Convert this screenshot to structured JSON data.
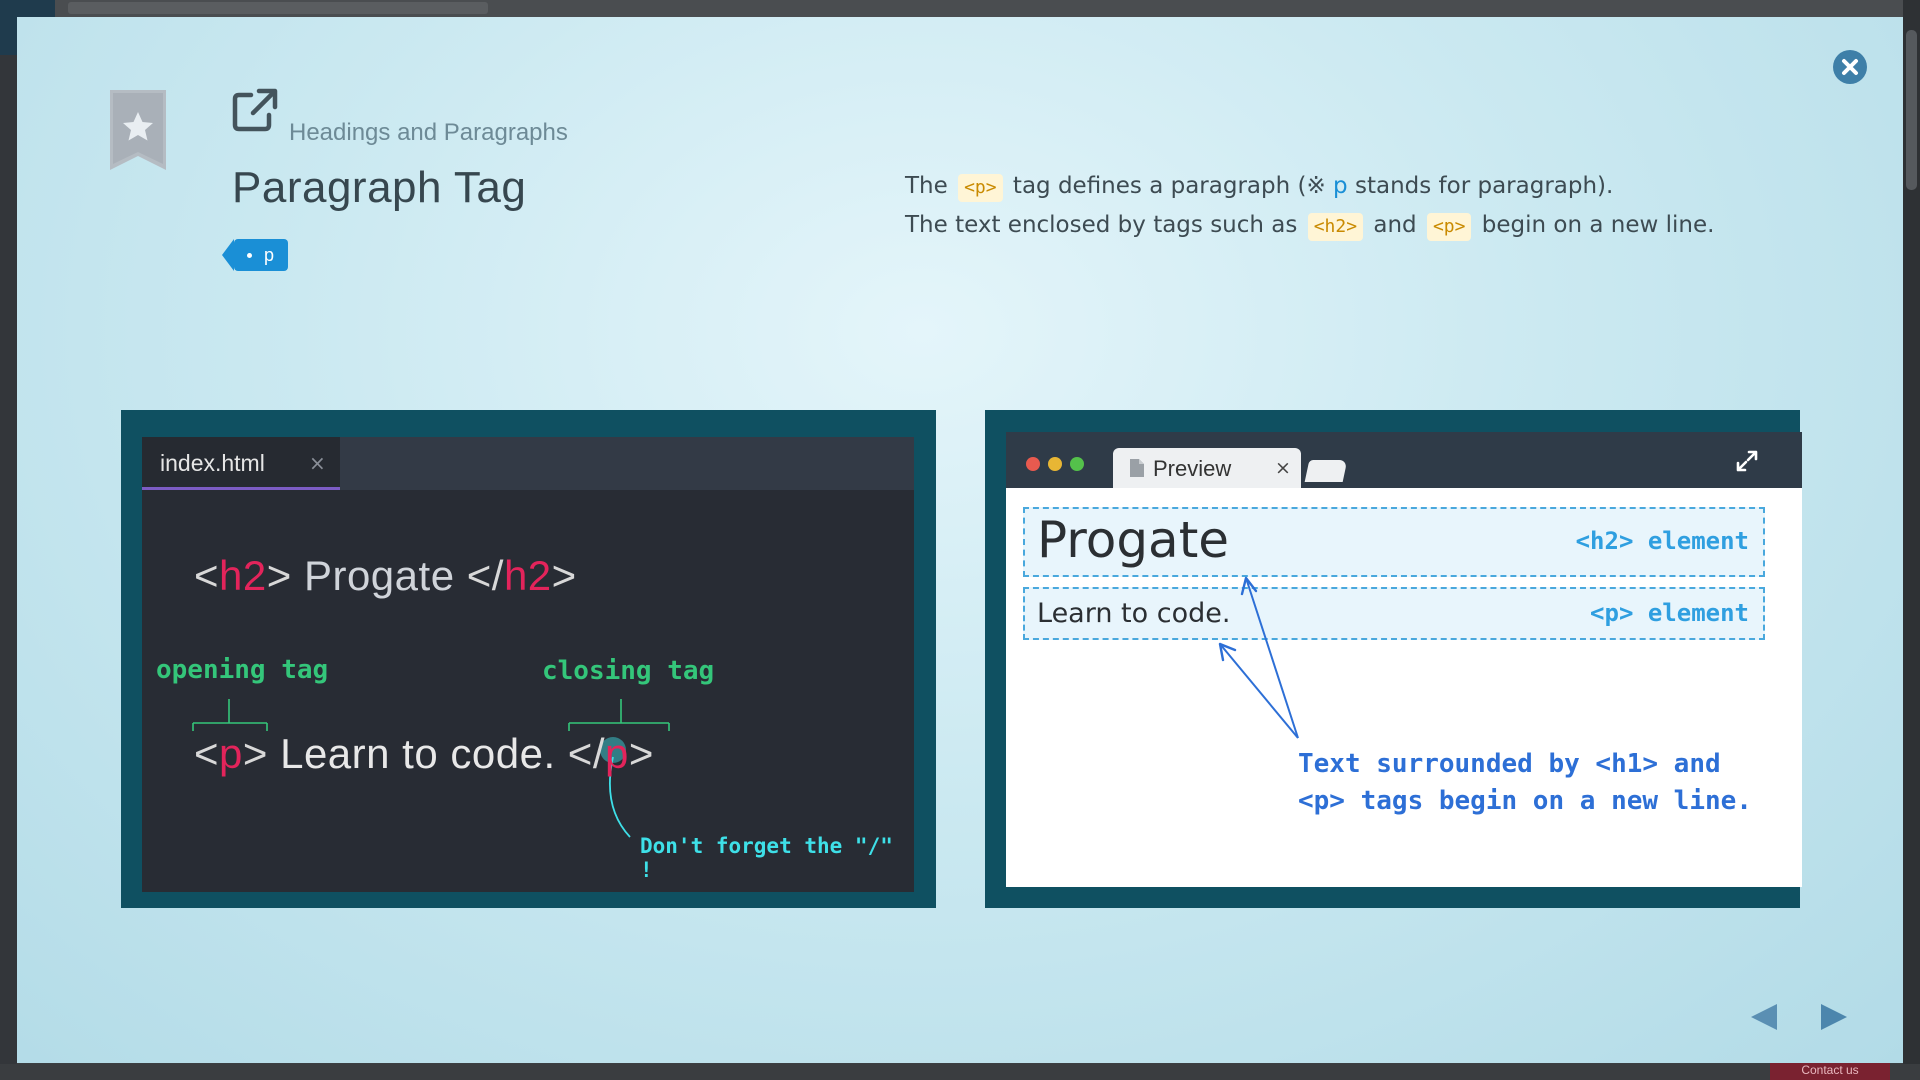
{
  "modal": {
    "category": "Headings and Paragraphs",
    "title": "Paragraph Tag",
    "tag_chip": "p",
    "description": {
      "line1_a": "The ",
      "line1_code": "<p>",
      "line1_b": " tag defines a paragraph (※ ",
      "line1_hl": "p",
      "line1_c": " stands for paragraph).",
      "line2_a": "The text enclosed by tags such as ",
      "line2_code1": "<h2>",
      "line2_b": " and ",
      "line2_code2": "<p>",
      "line2_c": " begin on a new line."
    }
  },
  "editor": {
    "tab_name": "index.html",
    "tab_close": "×",
    "line1": {
      "open_lt": "<",
      "open_tag": "h2",
      "open_gt": ">",
      "text": " Progate ",
      "close_lt": "</",
      "close_tag": "h2",
      "close_gt": ">"
    },
    "line2": {
      "open_lt": "<",
      "open_tag": "p",
      "open_gt": ">",
      "text": " Learn to code. ",
      "close_lt": "</",
      "close_tag": "p",
      "close_gt": ">"
    },
    "opening_label": "opening tag",
    "closing_label": "closing tag",
    "slash_note": "Don't forget the \"/\" !"
  },
  "preview": {
    "tab_label": "Preview",
    "tab_close": "×",
    "h2_text": "Progate",
    "h2_label": "<h2> element",
    "p_text": "Learn to code.",
    "p_label": "<p> element",
    "note_line1": "Text surrounded by <h1> and",
    "note_line2": "<p> tags begin on a new line."
  },
  "background": {
    "contact": "Contact us"
  },
  "colors": {
    "accent_blue": "#1a8fd6",
    "tag_pink": "#e3245b",
    "anno_green": "#34c67a",
    "anno_cyan": "#3ee0e8",
    "anno_blue": "#2d6fd6",
    "panel_teal": "#0f5061"
  },
  "icons": {
    "close": "close-circle-icon",
    "bookmark": "bookmark-star-icon",
    "external": "external-link-icon",
    "expand": "expand-icon",
    "file": "file-icon",
    "prev": "triangle-left-icon",
    "next": "triangle-right-icon"
  }
}
